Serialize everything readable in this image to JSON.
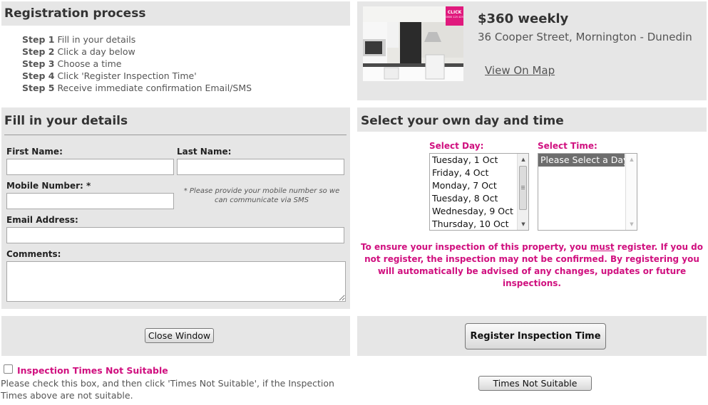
{
  "registration": {
    "title": "Registration process",
    "steps": [
      {
        "label": "Step 1",
        "text": "Fill in your details"
      },
      {
        "label": "Step 2",
        "text": "Click a day below"
      },
      {
        "label": "Step 3",
        "text": "Choose a time"
      },
      {
        "label": "Step 4",
        "text": "Click 'Register Inspection Time'"
      },
      {
        "label": "Step 5",
        "text": "Receive immediate confirmation Email/SMS"
      }
    ]
  },
  "property": {
    "price": "$360 weekly",
    "address": "36 Cooper Street, Mornington - Dunedin",
    "map_link": "View On Map",
    "logo_text": "CLICK",
    "logo_phone": "0800 125 425"
  },
  "details": {
    "title": "Fill in your details",
    "first_name_label": "First Name:",
    "first_name_value": "",
    "last_name_label": "Last Name:",
    "last_name_value": "",
    "mobile_label": "Mobile Number: *",
    "mobile_value": "",
    "mobile_note": "* Please provide your mobile number so we can communicate via SMS",
    "email_label": "Email Address:",
    "email_value": "",
    "comments_label": "Comments:",
    "comments_value": ""
  },
  "schedule": {
    "title": "Select your own day and time",
    "day_label": "Select Day:",
    "days": [
      "Tuesday, 1 Oct",
      "Friday, 4 Oct",
      "Monday, 7 Oct",
      "Tuesday, 8 Oct",
      "Wednesday, 9 Oct",
      "Thursday, 10 Oct"
    ],
    "time_label": "Select Time:",
    "times": [
      "Please Select a Day"
    ],
    "warning_pre": "To ensure your inspection of this property, you ",
    "warning_emph": "must",
    "warning_post": " register. If you do not register, the inspection may not be confirmed. By registering you will automatically be advised of any changes, updates or future inspections."
  },
  "actions": {
    "close_label": "Close Window",
    "register_label": "Register Inspection Time",
    "not_suitable_label": "Inspection Times Not Suitable",
    "not_suitable_checked": false,
    "not_suitable_help": "Please check this box, and then click 'Times Not Suitable', if the Inspection Times above are not suitable.",
    "times_not_suitable_button": "Times Not Suitable"
  },
  "colors": {
    "accent_pink": "#d0107f",
    "panel_grey": "#e6e6e6"
  }
}
